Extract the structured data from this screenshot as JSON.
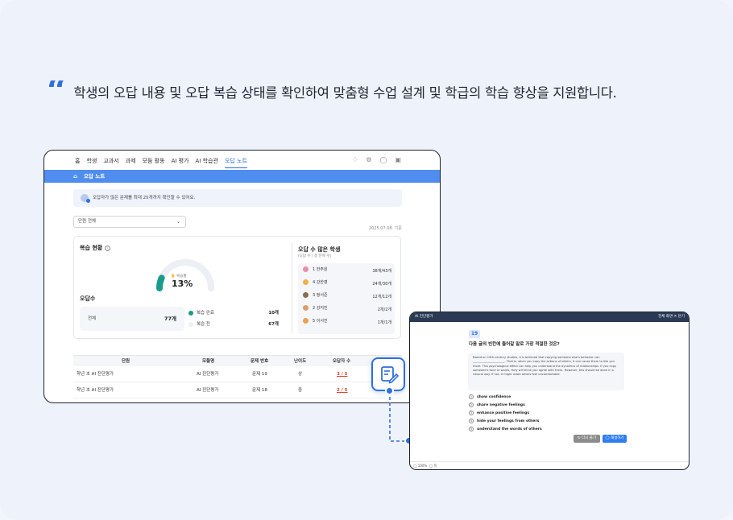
{
  "headline": {
    "text": "학생의 오답 내용 및 오답 복습 상태를 확인하여 맞춤형 수업 설계 및 학급의 학습 향상을 지원합니다."
  },
  "nav": {
    "items": [
      "홈",
      "학생",
      "교과서",
      "과제",
      "모둠 활동",
      "AI 평가",
      "AI 학습관",
      "오답 노트"
    ],
    "active": "오답 노트"
  },
  "page": {
    "title": "오답 노트"
  },
  "notice": {
    "text": "오답자가 많은 문제를 최대 25개까지 확인할 수 있어요."
  },
  "filter": {
    "selected": "단원 전체"
  },
  "date": "2025.07.08. 기준",
  "review": {
    "title": "복습 현황",
    "gauge_label": "복습률",
    "gauge_value": "13%",
    "gauge_fraction": 0.13,
    "count_title": "오답수",
    "total_label": "전체",
    "total_value": "77개",
    "done_label": "복습 완료",
    "done_value": "10개",
    "todo_label": "복습 전",
    "todo_value": "67개"
  },
  "students": {
    "title": "오답 수 많은 학생",
    "subtitle": "(오답 수 / 총 문제 수)",
    "items": [
      {
        "name": "1 한주원",
        "count": "38개/43개"
      },
      {
        "name": "4 강한영",
        "count": "24개/30개"
      },
      {
        "name": "3 정서준",
        "count": "12개/12개"
      },
      {
        "name": "2 강지민",
        "count": "2개/2개"
      },
      {
        "name": "5 이서진",
        "count": "1개/1개"
      }
    ]
  },
  "table": {
    "headers": [
      "단원",
      "모듈명",
      "문제 번호",
      "난이도",
      "오답자 수"
    ],
    "rows": [
      {
        "unit": "학년 초 AI 진단평가",
        "module": "AI 진단평가",
        "num": "문제 19",
        "level": "상",
        "wrong": "3 / 5"
      },
      {
        "unit": "학년 초 AI 진단평가",
        "module": "AI 진단평가",
        "num": "문제 18",
        "level": "중",
        "wrong": "2 / 5"
      }
    ]
  },
  "detail": {
    "header": "AI 진단평가",
    "header_right": "전체 화면  ✕ 닫기",
    "num": "19",
    "question": "다음 글의 빈칸에 들어갈 말로 가장 적절한 것은?",
    "passage": "Based on 19th-century studies, it is believed that copying someone else's behavior can ______________________. That is, when you copy the actions of others, it can cause them to like you more. This psychological effect can help you understand the dynamics of relationships. If you copy someone's tone or words, they will think you agree with them. However, this should be done in a natural way. If not, it might make others feel uncomfortable.",
    "options": [
      "show confidence",
      "share negative feelings",
      "enhance positive feelings",
      "hide your feelings from others",
      "understand the words of others"
    ],
    "retry": "다시 풀기",
    "explain": "해설하기",
    "footer_zoom": "100%",
    "footer_mode": "목"
  },
  "colors": {
    "accent": "#2f6fe0",
    "bar": "#4f8def",
    "teal": "#1a9a8a",
    "wrong": "#e0402e"
  }
}
